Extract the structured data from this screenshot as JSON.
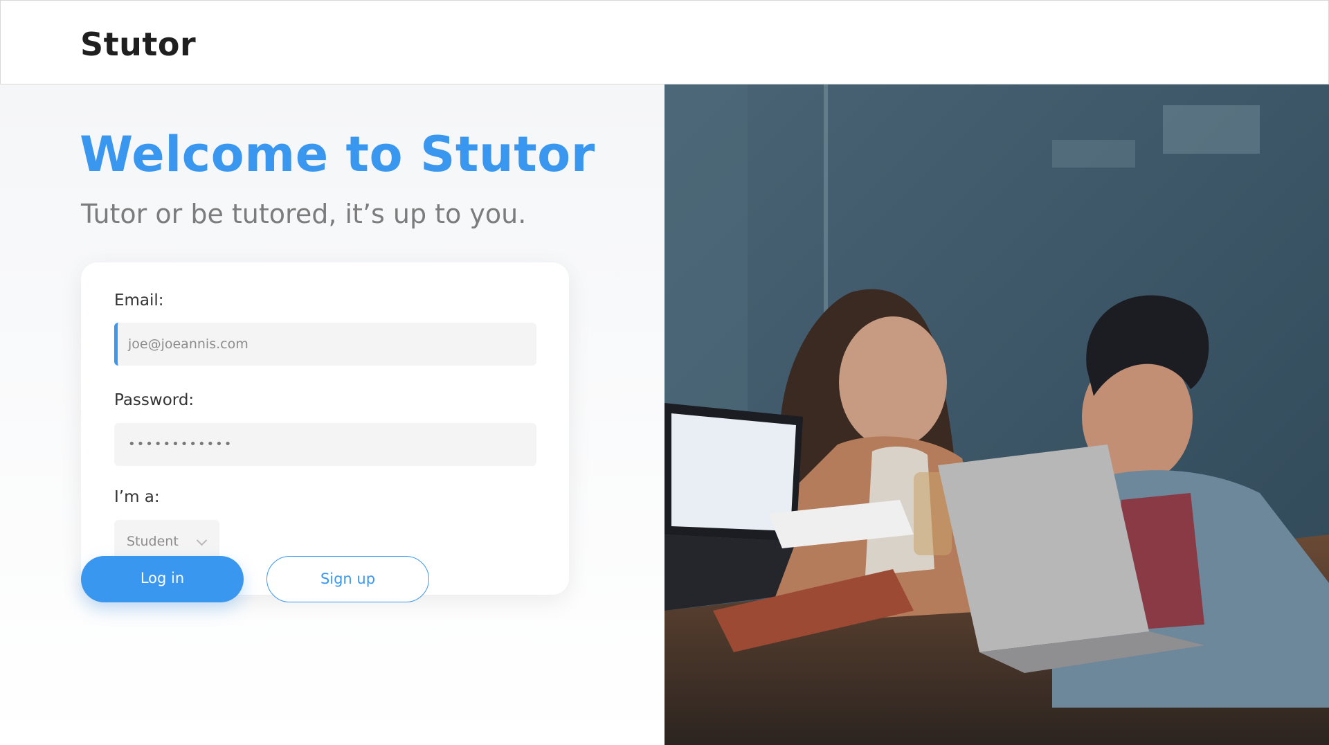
{
  "header": {
    "logo": "Stutor"
  },
  "hero": {
    "title": "Welcome to Stutor",
    "subtitle": "Tutor or be tutored, it’s up to you."
  },
  "form": {
    "email_label": "Email:",
    "email_placeholder": "joe@joeannis.com",
    "password_label": "Password:",
    "password_value": "••••••••••••",
    "role_label": "I’m a:",
    "role_value": "Student"
  },
  "buttons": {
    "login": "Log in",
    "signup": "Sign up"
  },
  "colors": {
    "accent": "#3a97ef"
  }
}
